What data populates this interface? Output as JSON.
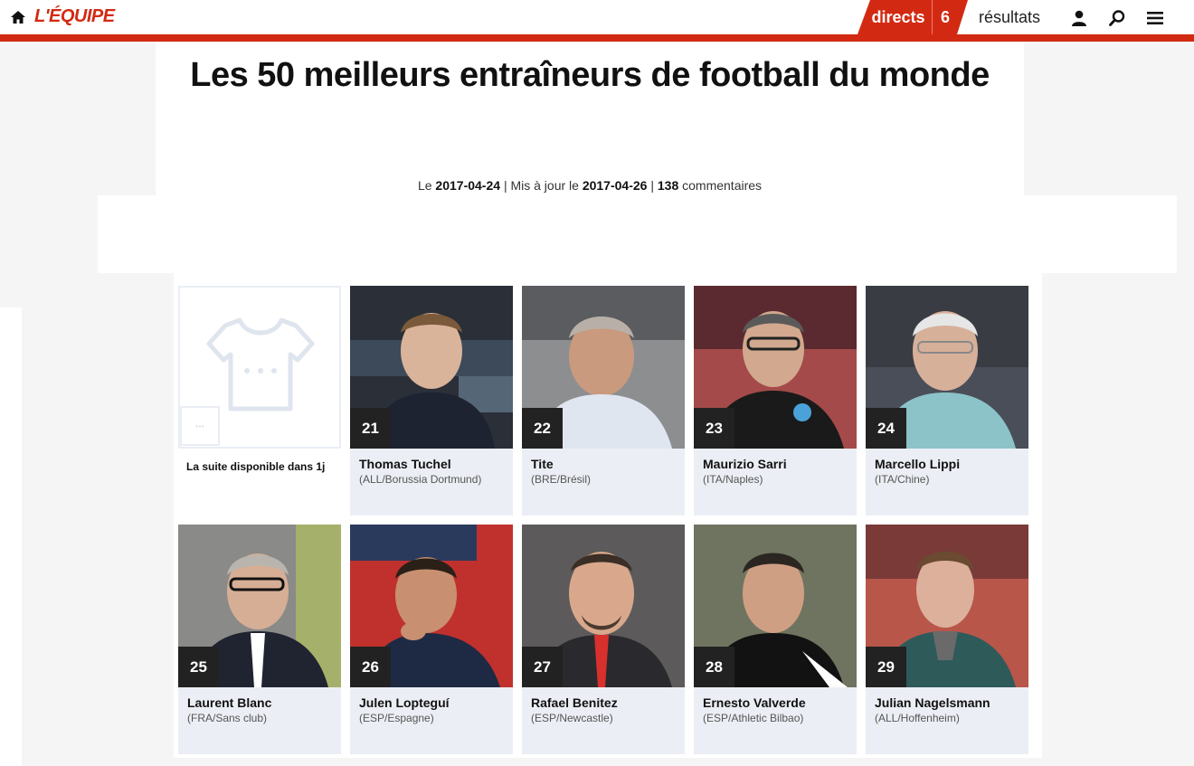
{
  "header": {
    "logo": "L'ÉQUIPE",
    "directs_label": "directs",
    "directs_count": "6",
    "resultats_label": "résultats",
    "icons": [
      "home-icon",
      "user-icon",
      "search-icon",
      "menu-icon"
    ],
    "brand_color": "#d22a12"
  },
  "article": {
    "title": "Les 50 meilleurs entraîneurs de football du monde",
    "meta": {
      "published_prefix": "Le",
      "published_date": "2017-04-24",
      "updated_prefix": "| Mis à jour le",
      "updated_date": "2017-04-26",
      "separator": "|",
      "comments_count": "138",
      "comments_label": "commentaires"
    }
  },
  "placeholder": {
    "text": "La suite disponible dans 1j",
    "small_box_text": "...",
    "icon": "shirt-icon"
  },
  "coaches": [
    {
      "rank": "21",
      "name": "Thomas Tuchel",
      "info": "(ALL/Borussia Dortmund)"
    },
    {
      "rank": "22",
      "name": "Tite",
      "info": "(BRE/Brésil)"
    },
    {
      "rank": "23",
      "name": "Maurizio Sarri",
      "info": "(ITA/Naples)"
    },
    {
      "rank": "24",
      "name": "Marcello Lippi",
      "info": "(ITA/Chine)"
    },
    {
      "rank": "25",
      "name": "Laurent Blanc",
      "info": "(FRA/Sans club)"
    },
    {
      "rank": "26",
      "name": "Julen Lopteguí",
      "info": "(ESP/Espagne)"
    },
    {
      "rank": "27",
      "name": "Rafael Benitez",
      "info": "(ESP/Newcastle)"
    },
    {
      "rank": "28",
      "name": "Ernesto Valverde",
      "info": "(ESP/Athletic Bilbao)"
    },
    {
      "rank": "29",
      "name": "Julian Nagelsmann",
      "info": "(ALL/Hoffenheim)"
    }
  ]
}
